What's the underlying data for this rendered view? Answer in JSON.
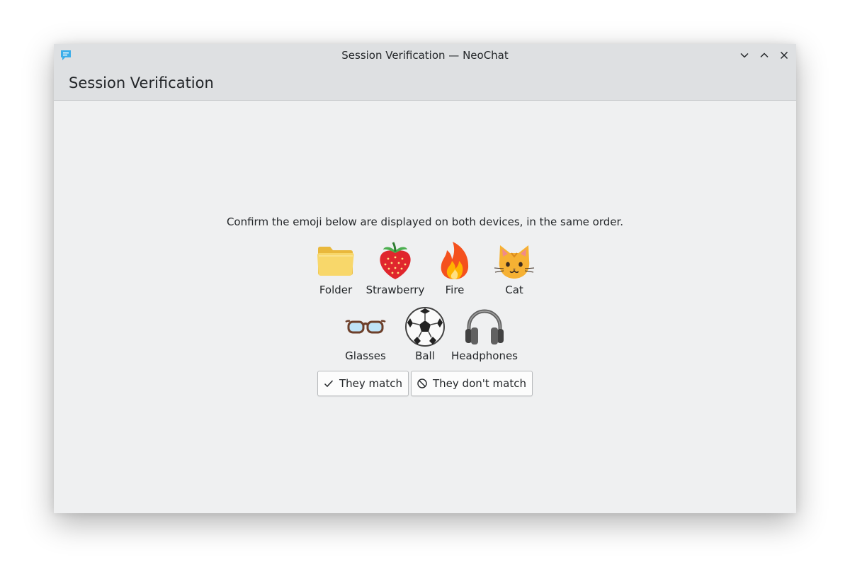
{
  "window": {
    "title": "Session Verification — NeoChat",
    "app_icon": "neochat-icon",
    "controls": [
      "minimize-icon",
      "maximize-icon",
      "close-icon"
    ]
  },
  "header": {
    "title": "Session Verification"
  },
  "main": {
    "instructions": "Confirm the emoji below are displayed on both devices, in the same order.",
    "emoji_row1": [
      {
        "icon": "folder-emoji",
        "label": "Folder"
      },
      {
        "icon": "strawberry-emoji",
        "label": "Strawberry"
      },
      {
        "icon": "fire-emoji",
        "label": "Fire"
      },
      {
        "icon": "cat-emoji",
        "label": "Cat"
      }
    ],
    "emoji_row2": [
      {
        "icon": "glasses-emoji",
        "label": "Glasses"
      },
      {
        "icon": "ball-emoji",
        "label": "Ball"
      },
      {
        "icon": "headphones-emoji",
        "label": "Headphones"
      }
    ],
    "actions": {
      "match_label": "They match",
      "match_icon": "checkmark-icon",
      "mismatch_label": "They don't match",
      "mismatch_icon": "cancel-icon"
    }
  },
  "colors": {
    "window_bg": "#eff0f1",
    "titlebar_bg": "#dee0e2",
    "text": "#232629",
    "button_bg": "#fcfcfc",
    "button_border": "#b7b9bc"
  }
}
